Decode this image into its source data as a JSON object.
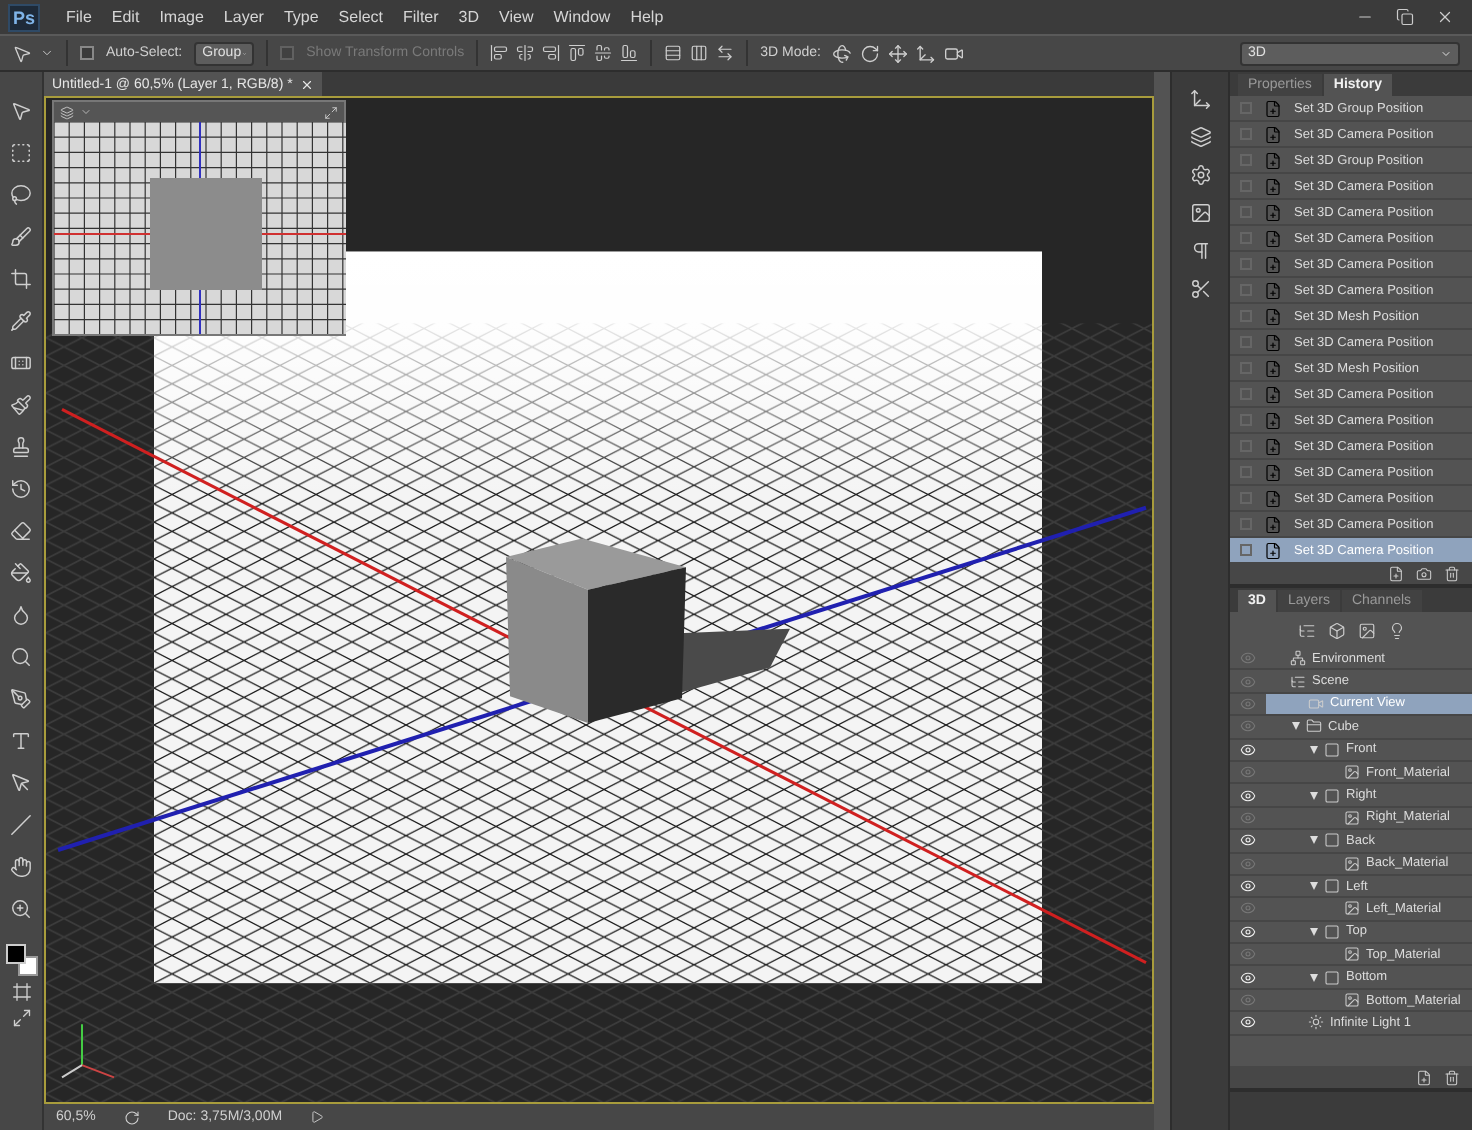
{
  "app_logo": "Ps",
  "menu": [
    "File",
    "Edit",
    "Image",
    "Layer",
    "Type",
    "Select",
    "Filter",
    "3D",
    "View",
    "Window",
    "Help"
  ],
  "options": {
    "auto_select": {
      "label": "Auto-Select:",
      "checked": false
    },
    "select_target": "Group",
    "transform_controls": {
      "label": "Show Transform Controls",
      "checked": false,
      "disabled": true
    },
    "mode_label": "3D Mode:",
    "workspace": "3D"
  },
  "document": {
    "tab": "Untitled-1 @ 60,5% (Layer 1, RGB/8) *",
    "zoom": "60,5%",
    "doc_size": "Doc: 3,75M/3,00M"
  },
  "history_panel": {
    "tabs": [
      {
        "label": "Properties",
        "selected": false
      },
      {
        "label": "History",
        "selected": true
      }
    ],
    "items": [
      {
        "label": "Set 3D Group Position",
        "selected": false
      },
      {
        "label": "Set 3D Camera Position",
        "selected": false
      },
      {
        "label": "Set 3D Group Position",
        "selected": false
      },
      {
        "label": "Set 3D Camera Position",
        "selected": false
      },
      {
        "label": "Set 3D Camera Position",
        "selected": false
      },
      {
        "label": "Set 3D Camera Position",
        "selected": false
      },
      {
        "label": "Set 3D Camera Position",
        "selected": false
      },
      {
        "label": "Set 3D Camera Position",
        "selected": false
      },
      {
        "label": "Set 3D Mesh Position",
        "selected": false
      },
      {
        "label": "Set 3D Camera Position",
        "selected": false
      },
      {
        "label": "Set 3D Mesh Position",
        "selected": false
      },
      {
        "label": "Set 3D Camera Position",
        "selected": false
      },
      {
        "label": "Set 3D Camera Position",
        "selected": false
      },
      {
        "label": "Set 3D Camera Position",
        "selected": false
      },
      {
        "label": "Set 3D Camera Position",
        "selected": false
      },
      {
        "label": "Set 3D Camera Position",
        "selected": false
      },
      {
        "label": "Set 3D Camera Position",
        "selected": false
      },
      {
        "label": "Set 3D Camera Position",
        "selected": true
      }
    ]
  },
  "scene_panel": {
    "tabs": [
      {
        "label": "3D",
        "selected": true
      },
      {
        "label": "Layers",
        "selected": false
      },
      {
        "label": "Channels",
        "selected": false
      }
    ],
    "tree": [
      {
        "kind": "environment",
        "label": "Environment",
        "visible": false,
        "selected": false
      },
      {
        "kind": "scene",
        "label": "Scene",
        "visible": false,
        "selected": false,
        "children": [
          {
            "kind": "camera",
            "label": "Current View",
            "visible": false,
            "selected": true
          },
          {
            "kind": "group",
            "label": "Cube",
            "visible": false,
            "selected": false,
            "expanded": true,
            "children": [
              {
                "kind": "mesh",
                "label": "Front",
                "visible": true,
                "selected": false,
                "expanded": true,
                "children": [
                  {
                    "kind": "material",
                    "label": "Front_Material",
                    "visible": false,
                    "selected": false
                  }
                ]
              },
              {
                "kind": "mesh",
                "label": "Right",
                "visible": true,
                "selected": false,
                "expanded": true,
                "children": [
                  {
                    "kind": "material",
                    "label": "Right_Material",
                    "visible": false,
                    "selected": false
                  }
                ]
              },
              {
                "kind": "mesh",
                "label": "Back",
                "visible": true,
                "selected": false,
                "expanded": true,
                "children": [
                  {
                    "kind": "material",
                    "label": "Back_Material",
                    "visible": false,
                    "selected": false
                  }
                ]
              },
              {
                "kind": "mesh",
                "label": "Left",
                "visible": true,
                "selected": false,
                "expanded": true,
                "children": [
                  {
                    "kind": "material",
                    "label": "Left_Material",
                    "visible": false,
                    "selected": false
                  }
                ]
              },
              {
                "kind": "mesh",
                "label": "Top",
                "visible": true,
                "selected": false,
                "expanded": true,
                "children": [
                  {
                    "kind": "material",
                    "label": "Top_Material",
                    "visible": false,
                    "selected": false
                  }
                ]
              },
              {
                "kind": "mesh",
                "label": "Bottom",
                "visible": true,
                "selected": false,
                "expanded": true,
                "children": [
                  {
                    "kind": "material",
                    "label": "Bottom_Material",
                    "visible": false,
                    "selected": false
                  }
                ]
              }
            ]
          },
          {
            "kind": "light",
            "label": "Infinite Light 1",
            "visible": true,
            "selected": false
          }
        ]
      }
    ]
  }
}
